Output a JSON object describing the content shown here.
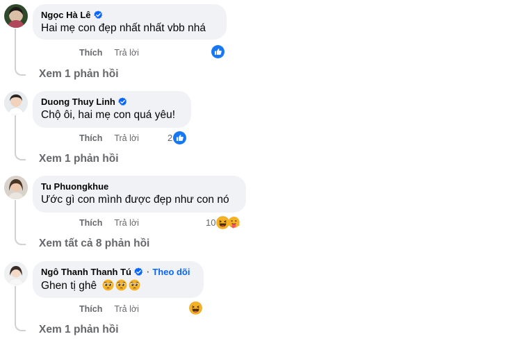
{
  "comments": [
    {
      "author": "Ngọc Hà Lê",
      "verified": true,
      "text": "Hai mẹ con đẹp nhất nhất vbb nhá",
      "like_label": "Thích",
      "reply_label": "Trả lời",
      "reaction_count": "",
      "reactions": [
        "like-icon"
      ],
      "replies_link": "Xem 1 phản hồi"
    },
    {
      "author": "Duong Thuy Linh",
      "verified": true,
      "text": "Chộ ôi, hai mẹ con quá yêu!",
      "like_label": "Thích",
      "reply_label": "Trả lời",
      "reaction_count": "2",
      "reactions": [
        "like-icon"
      ],
      "replies_link": "Xem 1 phản hồi"
    },
    {
      "author": "Tu Phuongkhue",
      "verified": false,
      "text": "Ước gì con mình được đẹp như con nó",
      "like_label": "Thích",
      "reply_label": "Trả lời",
      "reaction_count": "10",
      "reactions": [
        "haha-icon",
        "care-icon"
      ],
      "replies_link": "Xem tất cả 8 phản hồi"
    },
    {
      "author": "Ngô Thanh Thanh Tú",
      "verified": true,
      "follow_dot": "·",
      "follow_label": "Theo dõi",
      "text": "Ghen tị ghê",
      "text_emojis": [
        "pleading-face-icon",
        "pleading-face-icon",
        "pleading-face-icon"
      ],
      "like_label": "Thích",
      "reply_label": "Trả lời",
      "reaction_count": "",
      "reactions": [
        "haha-icon"
      ],
      "replies_link": "Xem 1 phản hồi"
    }
  ],
  "colors": {
    "bubble": "#f0f2f5",
    "link_blue": "#0866ff",
    "secondary_text": "#65676b",
    "like_blue": "#1877f2",
    "haha_yellow": "#f7b125"
  }
}
